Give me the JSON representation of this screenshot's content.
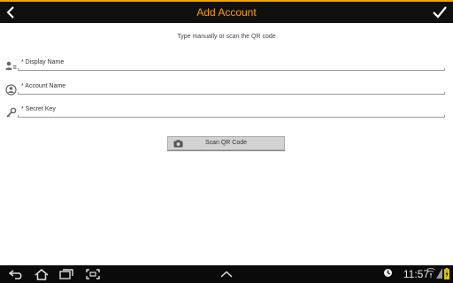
{
  "actionbar": {
    "title": "Add Account",
    "back_icon": "chevron-left-icon",
    "done_icon": "checkmark-icon"
  },
  "instruction": "Type manually or scan the QR code",
  "fields": [
    {
      "label": "* Display Name",
      "icon": "person-list-icon"
    },
    {
      "label": "* Account Name",
      "icon": "account-circle-icon"
    },
    {
      "label": "* Secret Key",
      "icon": "key-icon"
    }
  ],
  "scan_button": {
    "label": "Scan QR Code",
    "icon": "camera-icon"
  },
  "statusbar": {
    "time": "11:57"
  },
  "colors": {
    "accent": "#f5a000",
    "bar": "#101010"
  }
}
